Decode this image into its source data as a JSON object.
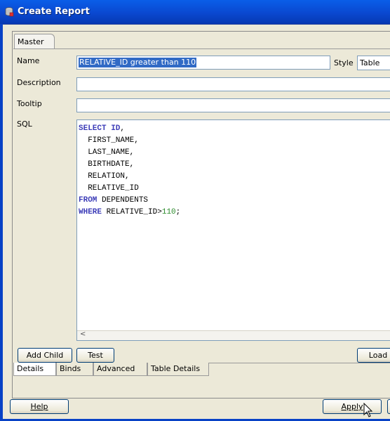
{
  "window": {
    "title": "Create Report"
  },
  "master_tab": {
    "label": "Master"
  },
  "form": {
    "name_label": "Name",
    "name_value": "RELATIVE_ID greater than 110",
    "style_label": "Style",
    "style_value": "Table",
    "description_label": "Description",
    "tooltip_label": "Tooltip",
    "sql_label": "SQL"
  },
  "sql": {
    "lines": [
      [
        {
          "t": "SELECT ID",
          "k": "kw"
        },
        {
          "t": ",",
          "k": ""
        }
      ],
      [
        {
          "t": "  FIRST_NAME,",
          "k": ""
        }
      ],
      [
        {
          "t": "  LAST_NAME,",
          "k": ""
        }
      ],
      [
        {
          "t": "  BIRTHDATE,",
          "k": ""
        }
      ],
      [
        {
          "t": "  RELATION,",
          "k": ""
        }
      ],
      [
        {
          "t": "  RELATIVE_ID",
          "k": ""
        }
      ],
      [
        {
          "t": "FROM",
          "k": "kw"
        },
        {
          "t": " DEPENDENTS",
          "k": ""
        }
      ],
      [
        {
          "t": "WHERE",
          "k": "kw"
        },
        {
          "t": " RELATIVE_ID>",
          "k": ""
        },
        {
          "t": "110",
          "k": "num"
        },
        {
          "t": ";",
          "k": ""
        }
      ]
    ]
  },
  "buttons": {
    "add_child": "Add Child",
    "test": "Test",
    "load": "Load",
    "help": "Help",
    "apply": "Apply"
  },
  "bottom_tabs": [
    "Details",
    "Binds",
    "Advanced",
    "Table Details"
  ]
}
